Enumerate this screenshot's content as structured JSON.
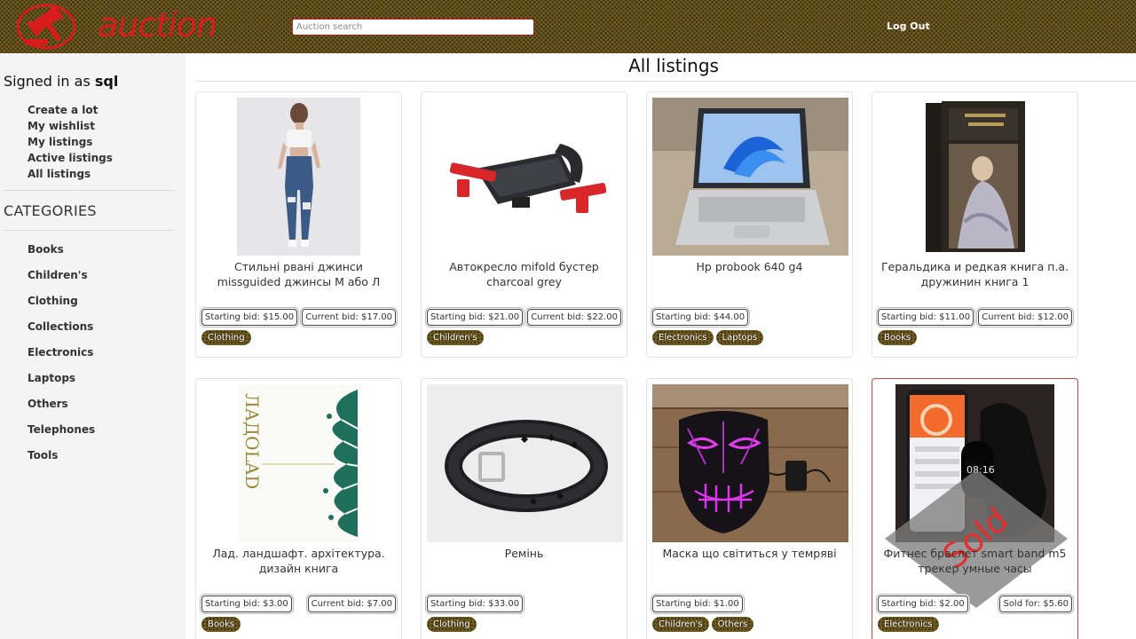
{
  "header": {
    "logo_text": "auction",
    "search_placeholder": "Auction search",
    "logout_label": "Log Out"
  },
  "sidebar": {
    "signed_prefix": "Signed in as",
    "username": "sql",
    "menu": [
      "Create a lot",
      "My wishlist",
      "My listings",
      "Active listings",
      "All listings"
    ],
    "categories_title": "CATEGORIES",
    "categories": [
      "Books",
      "Children's",
      "Clothing",
      "Collections",
      "Electronics",
      "Laptops",
      "Others",
      "Telephones",
      "Tools"
    ]
  },
  "main": {
    "title": "All listings"
  },
  "listings": [
    {
      "name": "Стильні рвані джинси missguided джинсы М або Л",
      "starting": "Starting bid: $15.00",
      "current": "Current bid: $17.00",
      "tags": [
        "Clothing"
      ],
      "image": "jeans-photo"
    },
    {
      "name": "Автокресло mifold бустер charcoal grey",
      "starting": "Starting bid: $21.00",
      "current": "Current bid: $22.00",
      "tags": [
        "Children's"
      ],
      "image": "car-seat-photo"
    },
    {
      "name": "Hp probook 640 g4",
      "starting": "Starting bid: $44.00",
      "current": "",
      "tags": [
        "Electronics",
        "Laptops"
      ],
      "image": "laptop-photo"
    },
    {
      "name": "Геральдика и редкая книга п.а. дружинин книга 1",
      "starting": "Starting bid: $11.00",
      "current": "Current bid: $12.00",
      "tags": [
        "Books"
      ],
      "image": "book-photo"
    },
    {
      "name": "Лад. ландшафт. архітектура. дизайн книга",
      "starting": "Starting bid: $3.00",
      "current": "Current bid: $7.00",
      "tags": [
        "Books"
      ],
      "image": "book-cover-photo"
    },
    {
      "name": "Ремінь",
      "starting": "Starting bid: $33.00",
      "current": "",
      "tags": [
        "Clothing"
      ],
      "image": "belt-photo"
    },
    {
      "name": "Маска що світиться у темряві",
      "starting": "Starting bid: $1.00",
      "current": "",
      "tags": [
        "Children's",
        "Others"
      ],
      "image": "led-mask-photo"
    },
    {
      "name": "Фитнес браслет smart band m5 трекер умные часы",
      "starting": "Starting bid: $2.00",
      "current": "Sold for: $5.60",
      "tags": [
        "Electronics"
      ],
      "image": "smart-band-photo",
      "sold_label": "Sold"
    }
  ],
  "colors": {
    "header_bg": "#6e5a20",
    "logo_red": "#d81c1c",
    "sold_border": "#cc4444"
  }
}
